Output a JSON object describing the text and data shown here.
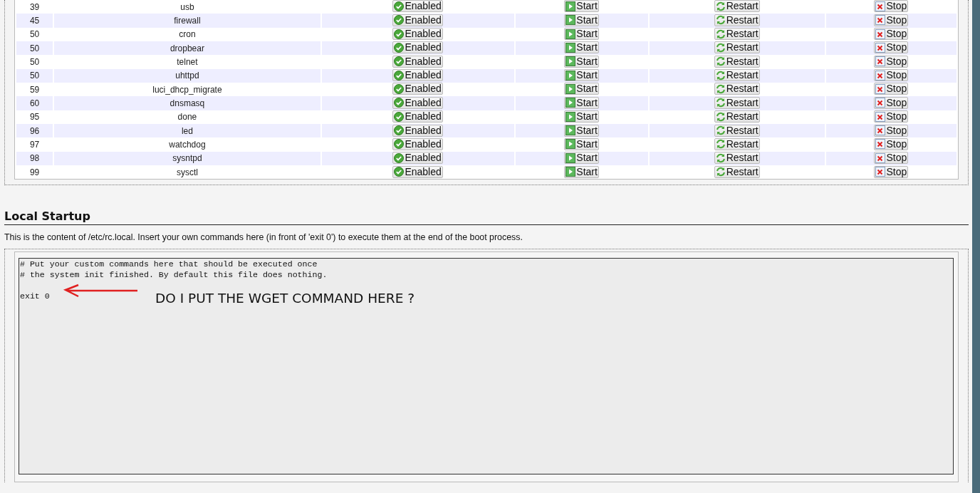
{
  "services": [
    {
      "priority": "39",
      "name": "usb",
      "enabled": "Enabled",
      "start": "Start",
      "restart": "Restart",
      "stop": "Stop"
    },
    {
      "priority": "45",
      "name": "firewall",
      "enabled": "Enabled",
      "start": "Start",
      "restart": "Restart",
      "stop": "Stop"
    },
    {
      "priority": "50",
      "name": "cron",
      "enabled": "Enabled",
      "start": "Start",
      "restart": "Restart",
      "stop": "Stop"
    },
    {
      "priority": "50",
      "name": "dropbear",
      "enabled": "Enabled",
      "start": "Start",
      "restart": "Restart",
      "stop": "Stop"
    },
    {
      "priority": "50",
      "name": "telnet",
      "enabled": "Enabled",
      "start": "Start",
      "restart": "Restart",
      "stop": "Stop"
    },
    {
      "priority": "50",
      "name": "uhttpd",
      "enabled": "Enabled",
      "start": "Start",
      "restart": "Restart",
      "stop": "Stop"
    },
    {
      "priority": "59",
      "name": "luci_dhcp_migrate",
      "enabled": "Enabled",
      "start": "Start",
      "restart": "Restart",
      "stop": "Stop"
    },
    {
      "priority": "60",
      "name": "dnsmasq",
      "enabled": "Enabled",
      "start": "Start",
      "restart": "Restart",
      "stop": "Stop"
    },
    {
      "priority": "95",
      "name": "done",
      "enabled": "Enabled",
      "start": "Start",
      "restart": "Restart",
      "stop": "Stop"
    },
    {
      "priority": "96",
      "name": "led",
      "enabled": "Enabled",
      "start": "Start",
      "restart": "Restart",
      "stop": "Stop"
    },
    {
      "priority": "97",
      "name": "watchdog",
      "enabled": "Enabled",
      "start": "Start",
      "restart": "Restart",
      "stop": "Stop"
    },
    {
      "priority": "98",
      "name": "sysntpd",
      "enabled": "Enabled",
      "start": "Start",
      "restart": "Restart",
      "stop": "Stop"
    },
    {
      "priority": "99",
      "name": "sysctl",
      "enabled": "Enabled",
      "start": "Start",
      "restart": "Restart",
      "stop": "Stop"
    }
  ],
  "local_startup": {
    "title": "Local Startup",
    "description": "This is the content of /etc/rc.local. Insert your own commands here (in front of 'exit 0') to execute them at the end of the boot process.",
    "content": "# Put your custom commands here that should be executed once\n# the system init finished. By default this file does nothing.\n\nexit 0"
  },
  "annotation": {
    "text": "DO I PUT THE WGET COMMAND HERE ?"
  }
}
